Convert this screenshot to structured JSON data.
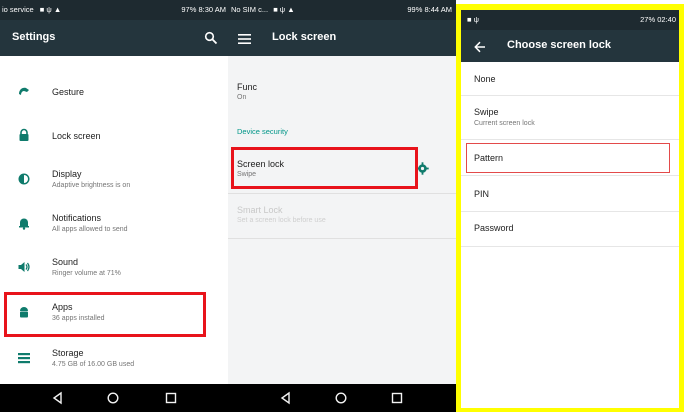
{
  "panel1": {
    "status": {
      "left": "io service",
      "right": "97% 8:30 AM"
    },
    "title": "Settings",
    "items": [
      {
        "title": "Gesture",
        "subtitle": ""
      },
      {
        "title": "Lock screen",
        "subtitle": ""
      },
      {
        "title": "Display",
        "subtitle": "Adaptive brightness is on"
      },
      {
        "title": "Notifications",
        "subtitle": "All apps allowed to send"
      },
      {
        "title": "Sound",
        "subtitle": "Ringer volume at 71%"
      },
      {
        "title": "Apps",
        "subtitle": "36 apps installed"
      },
      {
        "title": "Storage",
        "subtitle": "4.75 GB of 16.00 GB used"
      }
    ]
  },
  "panel2": {
    "status": {
      "left": "No SIM c...",
      "right": "99% 8:44 AM"
    },
    "title": "Lock screen",
    "func": {
      "title": "Func",
      "subtitle": "On"
    },
    "section": "Device security",
    "screen_lock": {
      "title": "Screen lock",
      "subtitle": "Swipe"
    },
    "smart_lock": {
      "title": "Smart Lock",
      "subtitle": "Set a screen lock before use"
    }
  },
  "panel3": {
    "status": {
      "right": "27% 02:40"
    },
    "title": "Choose screen lock",
    "options": [
      {
        "title": "None",
        "subtitle": ""
      },
      {
        "title": "Swipe",
        "subtitle": "Current screen lock"
      },
      {
        "title": "Pattern",
        "subtitle": ""
      },
      {
        "title": "PIN",
        "subtitle": ""
      },
      {
        "title": "Password",
        "subtitle": ""
      }
    ]
  },
  "colors": {
    "appbar": "#24353d",
    "statusbar": "#1e2a30",
    "accent": "#009688",
    "highlight": "#e8131b",
    "frame": "#ffff00"
  },
  "icons": [
    "search-icon",
    "menu-icon",
    "back-arrow-icon",
    "gear-icon",
    "nav-back-icon",
    "nav-home-icon",
    "nav-recents-icon"
  ]
}
